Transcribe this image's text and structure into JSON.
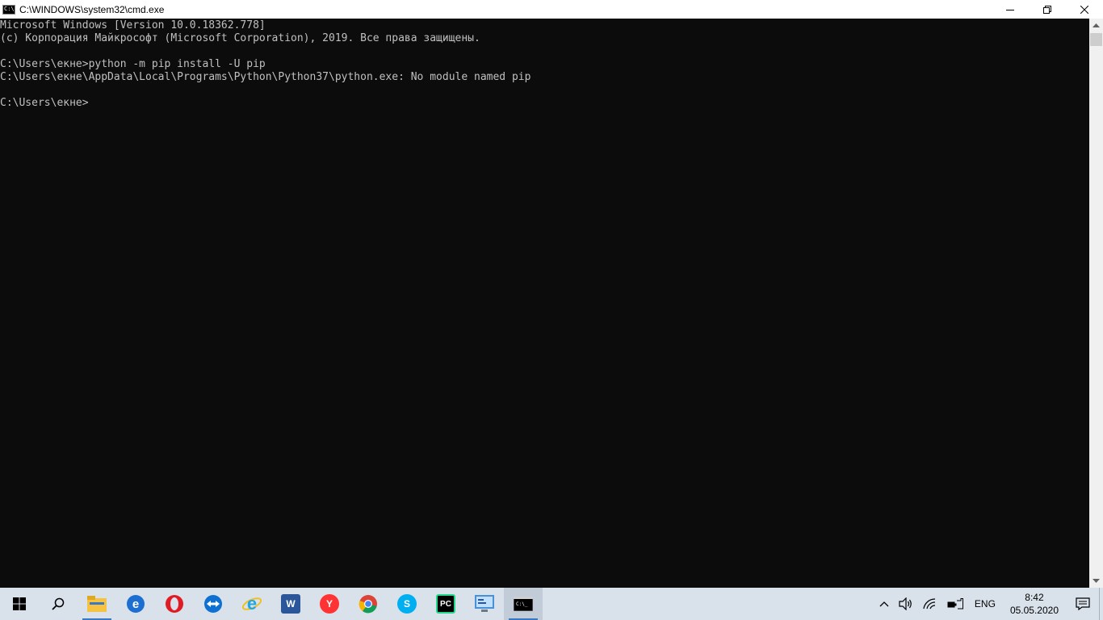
{
  "window": {
    "title": "C:\\WINDOWS\\system32\\cmd.exe",
    "icon_label": "C:\\"
  },
  "console": {
    "lines": [
      "Microsoft Windows [Version 10.0.18362.778]",
      "(c) Корпорация Майкрософт (Microsoft Corporation), 2019. Все права защищены.",
      "",
      "C:\\Users\\екне>python -m pip install -U pip",
      "C:\\Users\\екне\\AppData\\Local\\Programs\\Python\\Python37\\python.exe: No module named pip",
      "",
      "C:\\Users\\екне>"
    ]
  },
  "taskbar": {
    "apps": [
      {
        "icon": "file-explorer-icon",
        "color": "#f5c242"
      },
      {
        "icon": "edge-icon",
        "color": "#1c6fd1"
      },
      {
        "icon": "opera-icon",
        "color": "#e01b24"
      },
      {
        "icon": "teamviewer-icon",
        "color": "#0e70d2"
      },
      {
        "icon": "internet-explorer-icon",
        "color": "#1ea7e8"
      },
      {
        "icon": "word-icon",
        "color": "#2b579a",
        "glyph": "W"
      },
      {
        "icon": "yandex-browser-icon",
        "color": "#ff3333",
        "glyph": "Y"
      },
      {
        "icon": "chrome-icon",
        "color": "#db4437"
      },
      {
        "icon": "skype-icon",
        "color": "#00aff0",
        "glyph": "S"
      },
      {
        "icon": "pycharm-icon",
        "color": "#21d789",
        "glyph": "PC"
      },
      {
        "icon": "control-panel-icon",
        "color": "#4a90d9"
      },
      {
        "icon": "cmd-icon",
        "color": "#000000"
      }
    ],
    "tray": {
      "language": "ENG",
      "time": "8:42",
      "date": "05.05.2020"
    }
  },
  "colors": {
    "console_bg": "#0c0c0c",
    "console_fg": "#c0c0c0",
    "taskbar_bg": "#d9e1ea",
    "accent": "#3b78c3"
  }
}
